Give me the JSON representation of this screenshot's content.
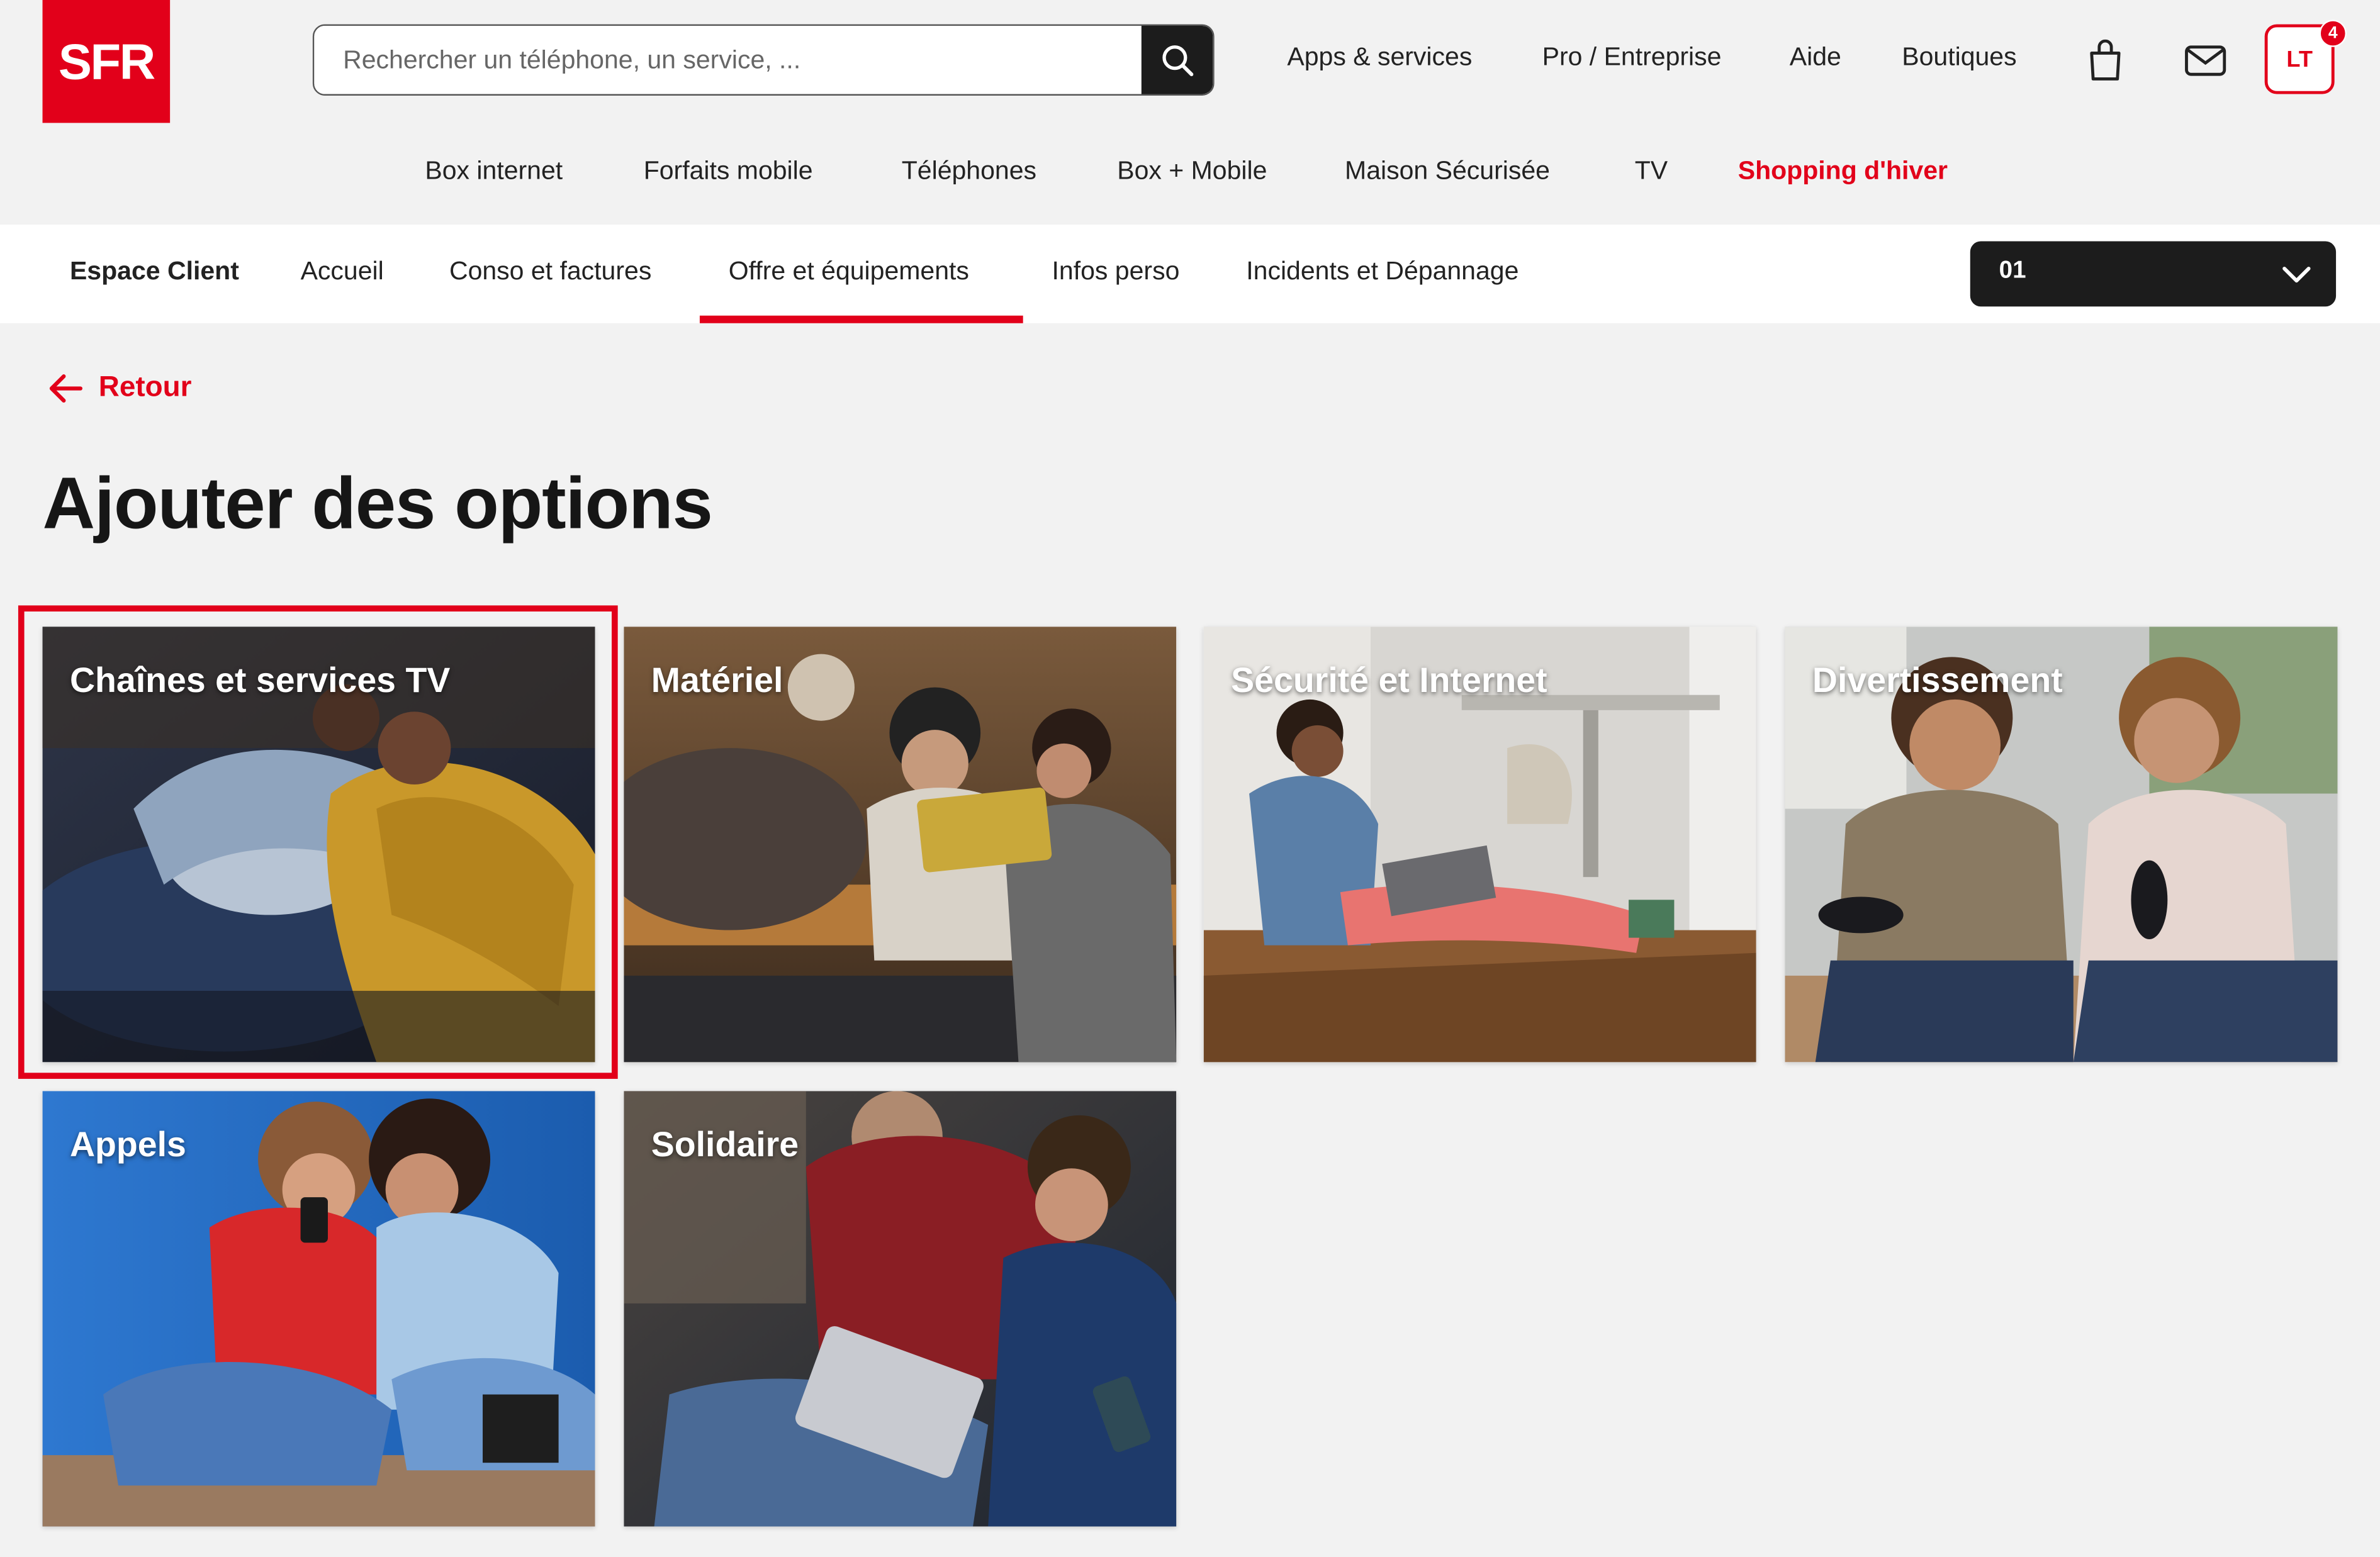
{
  "header": {
    "logo_text": "SFR",
    "search": {
      "placeholder": "Rechercher un téléphone, un service, ...",
      "icon": "search-icon"
    },
    "top_links": [
      "Apps & services",
      "Pro / Entreprise",
      "Aide",
      "Boutiques"
    ],
    "cart_icon": "shopping-bag-icon",
    "mail_icon": "mail-icon",
    "account": {
      "initials": "LT",
      "badge_count": "4"
    }
  },
  "main_nav": {
    "items": [
      "Box internet",
      "Forfaits mobile",
      "Téléphones",
      "Box + Mobile",
      "Maison Sécurisée",
      "TV",
      "Shopping d'hiver"
    ],
    "highlight_color": "#e2001a"
  },
  "client_bar": {
    "title": "Espace Client",
    "tabs": [
      "Accueil",
      "Conso et factures",
      "Offre et équipements",
      "Infos perso",
      "Incidents et Dépannage"
    ],
    "active_tab": "Offre et équipements",
    "line_selector": {
      "value": "01",
      "icon": "chevron-down-icon"
    }
  },
  "back": {
    "label": "Retour",
    "icon": "arrow-left-icon"
  },
  "page": {
    "title": "Ajouter des options"
  },
  "cards": [
    {
      "label": "Chaînes et services TV",
      "selected": true
    },
    {
      "label": "Matériel",
      "selected": false
    },
    {
      "label": "Sécurité et Internet",
      "selected": false
    },
    {
      "label": "Divertissement",
      "selected": false
    },
    {
      "label": "Appels",
      "selected": false
    },
    {
      "label": "Solidaire",
      "selected": false
    }
  ],
  "colors": {
    "brand_red": "#e2001a",
    "dark": "#1c1c1c",
    "background": "#f2f2f2"
  }
}
